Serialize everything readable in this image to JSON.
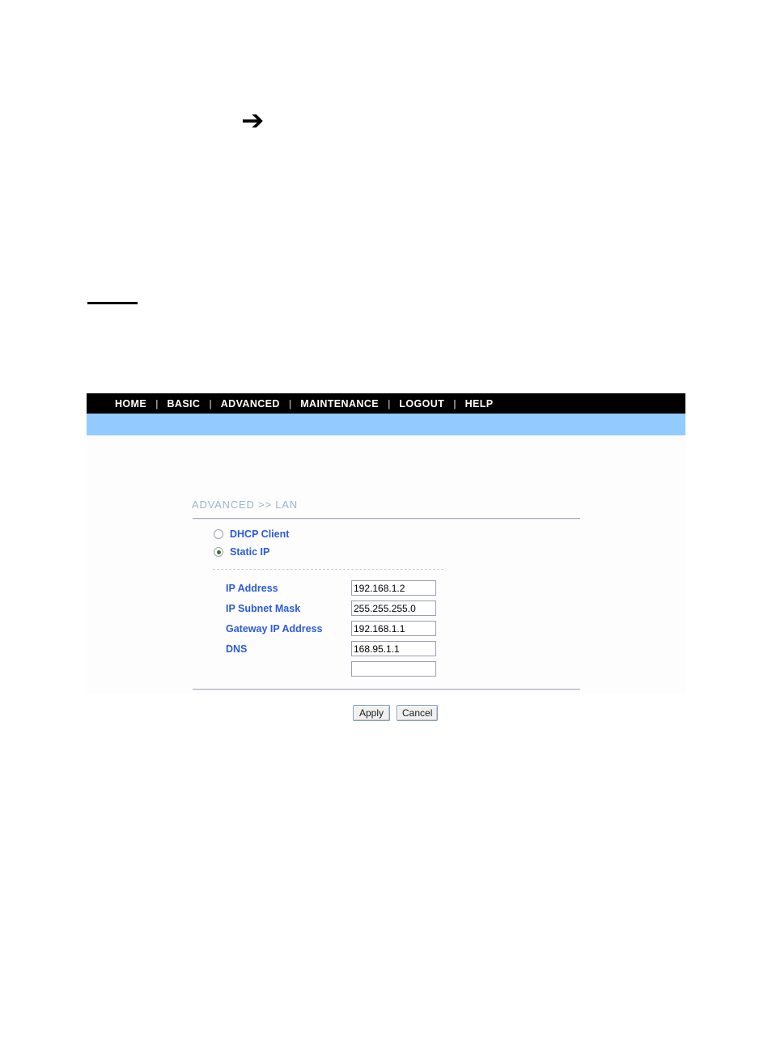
{
  "page": {
    "arrow_glyph": "➔"
  },
  "navbar": {
    "separator": "|",
    "items": [
      {
        "label": "HOME"
      },
      {
        "label": "BASIC"
      },
      {
        "label": "ADVANCED"
      },
      {
        "label": "MAINTENANCE"
      },
      {
        "label": "LOGOUT"
      },
      {
        "label": "HELP"
      }
    ]
  },
  "content": {
    "breadcrumb": "ADVANCED >> LAN",
    "mode_options": [
      {
        "label": "DHCP Client",
        "selected": false
      },
      {
        "label": "Static IP",
        "selected": true
      }
    ],
    "fields": [
      {
        "label": "IP Address",
        "value": "192.168.1.2"
      },
      {
        "label": "IP Subnet Mask",
        "value": "255.255.255.0"
      },
      {
        "label": "Gateway IP Address",
        "value": "192.168.1.1"
      },
      {
        "label": "DNS",
        "value": "168.95.1.1"
      },
      {
        "label": "",
        "value": ""
      }
    ],
    "buttons": {
      "apply": "Apply",
      "cancel": "Cancel"
    }
  },
  "colors": {
    "navbar_bg": "#000000",
    "band_blue": "#93caff",
    "label_blue": "#2b5bd7",
    "breadcrumb_blue": "#9db4cf",
    "panel_bg": "#fdfdfd"
  }
}
